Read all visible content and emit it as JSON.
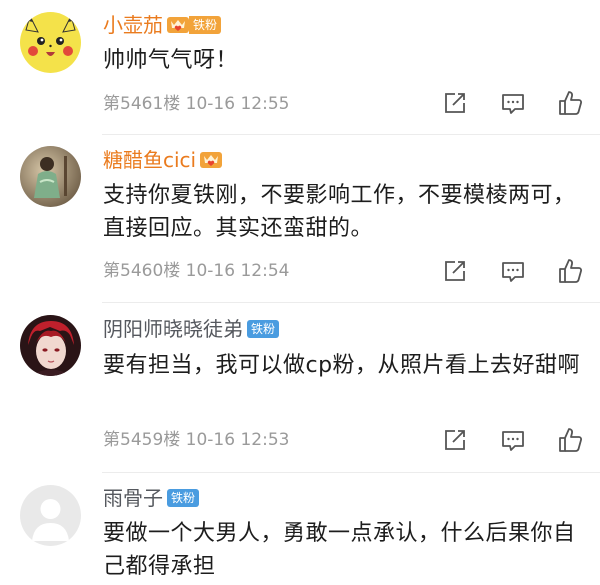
{
  "comments": [
    {
      "username": "小壶茄",
      "name_color": "orange",
      "badge_icon": "crown-heart-icon",
      "badge_label": "铁粉",
      "text": "帅帅气气呀！",
      "meta": "第5461楼 10-16 12:55",
      "avatar": "pikachu-avatar"
    },
    {
      "username": "糖醋鱼cici",
      "name_color": "orange",
      "badge_icon": "crown-heart-icon",
      "text": "支持你夏铁刚，不要影响工作，不要模棱两可，直接回应。其实还蛮甜的。",
      "meta": "第5460楼 10-16 12:54",
      "avatar": "photo-avatar"
    },
    {
      "username": "阴阳师晓晓徒弟",
      "name_color": "gray",
      "badge_label": "铁粉",
      "text": "要有担当，我可以做cp粉，从照片看上去好甜啊",
      "meta": "第5459楼 10-16 12:53",
      "avatar": "anime-avatar"
    },
    {
      "username": "雨骨子",
      "name_color": "gray",
      "badge_label": "铁粉",
      "text": "要做一个大男人，勇敢一点承认，什么后果你自己都得承担",
      "avatar": "default-avatar"
    }
  ],
  "actions": [
    "share-icon",
    "comment-icon",
    "like-icon"
  ],
  "colors": {
    "name_orange": "#ea7b1e",
    "name_gray": "#55585e",
    "fan_badge_orange": "#f2a33a",
    "fan_badge_blue": "#4a9ce0",
    "meta_gray": "#9a9a9a"
  }
}
